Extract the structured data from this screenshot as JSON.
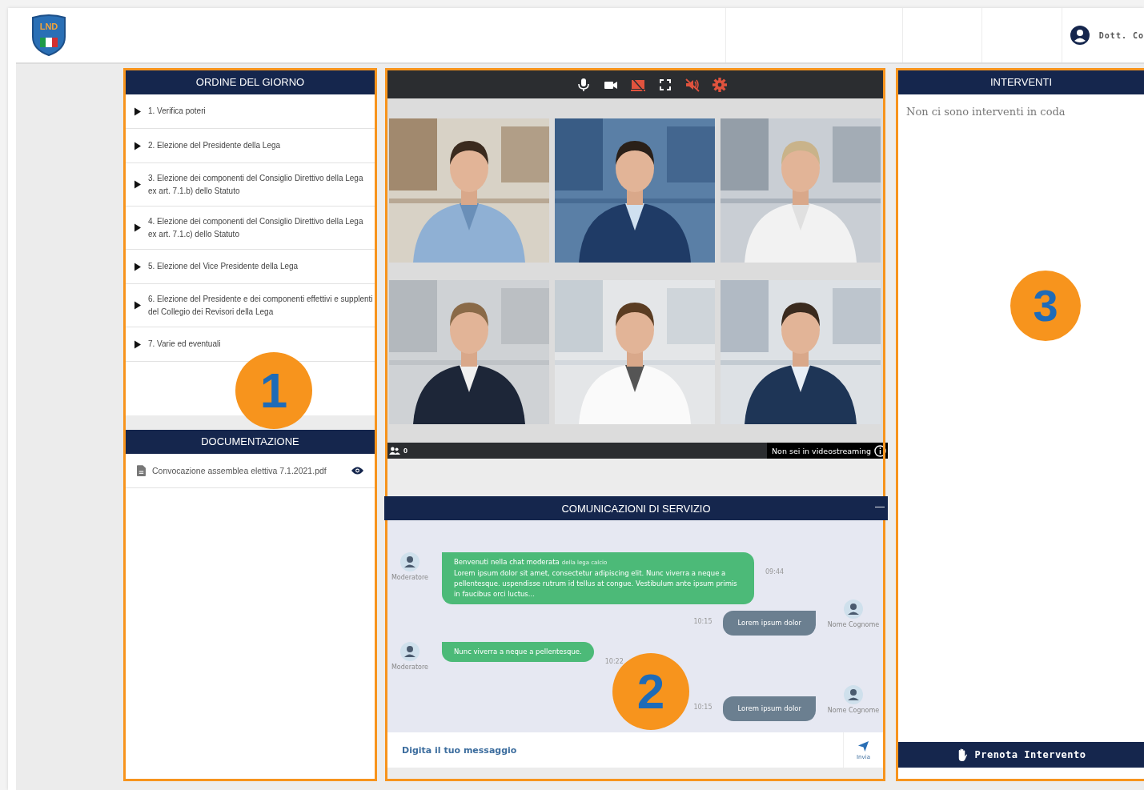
{
  "header": {
    "logo_text": "LND",
    "user": "Dott. Co"
  },
  "agenda": {
    "title": "ORDINE DEL GIORNO",
    "callout": "1",
    "items": [
      {
        "text": "1. Verifica poteri",
        "expanded": false
      },
      {
        "text": "2. Elezione del Presidente della Lega",
        "expanded": false
      },
      {
        "text": "3. Elezione dei componenti del Consiglio Direttivo della Lega ex art. 7.1.b) dello Statuto",
        "expanded": false
      },
      {
        "text": "4. Elezione dei componenti del Consiglio Direttivo della Lega ex art. 7.1.c) dello Statuto",
        "expanded": false
      },
      {
        "text": "5. Elezione del Vice Presidente della Lega",
        "expanded": false
      },
      {
        "text": "6. Elezione del Presidente e dei componenti effettivi e supplenti del Collegio dei Revisori della Lega",
        "expanded": false
      },
      {
        "text": "7. Varie ed eventuali",
        "expanded": false
      }
    ]
  },
  "documents": {
    "title": "DOCUMENTAZIONE",
    "files": [
      {
        "name": "Convocazione assemblea elettiva 7.1.2021.pdf"
      }
    ]
  },
  "video": {
    "callout": "2",
    "controls": [
      {
        "kind": "mic",
        "color": "#ffffff"
      },
      {
        "kind": "camera",
        "color": "#ffffff"
      },
      {
        "kind": "screen",
        "color": "#e0533e"
      },
      {
        "kind": "fullscreen",
        "color": "#ffffff"
      },
      {
        "kind": "speaker",
        "color": "#e0533e"
      },
      {
        "kind": "settings",
        "color": "#e0533e"
      }
    ],
    "participants": "0",
    "stream_status": "Non sei in videostreaming"
  },
  "chat": {
    "title": "COMUNICAZIONI DI SERVIZIO",
    "collapse": "—",
    "messages": [
      {
        "kind": "incoming",
        "author": "Moderatore",
        "title": "Benvenuti nella chat moderata",
        "title_note": "della lega calcio",
        "text": "Lorem ipsum dolor sit amet, consectetur adipiscing elit. Nunc viverra a neque a pellentesque. uspendisse rutrum id tellus at congue. Vestibulum ante ipsum primis in faucibus orci luctus...",
        "time": "09:44"
      },
      {
        "kind": "outgoing",
        "author": "Nome Cognome",
        "text": "Lorem ipsum dolor",
        "time": "10:15"
      },
      {
        "kind": "incoming",
        "author": "Moderatore",
        "text": "Nunc viverra a neque a pellentesque.",
        "time": "10:22"
      },
      {
        "kind": "outgoing",
        "author": "Nome Cognome",
        "text": "Lorem ipsum dolor",
        "time": "10:15"
      }
    ],
    "input": {
      "placeholder": "Digita il tuo messaggio"
    },
    "send": "Invia"
  },
  "interventions": {
    "title": "INTERVENTI",
    "callout": "3",
    "empty": "Non ci sono interventi in coda",
    "book": "Prenota Intervento"
  }
}
